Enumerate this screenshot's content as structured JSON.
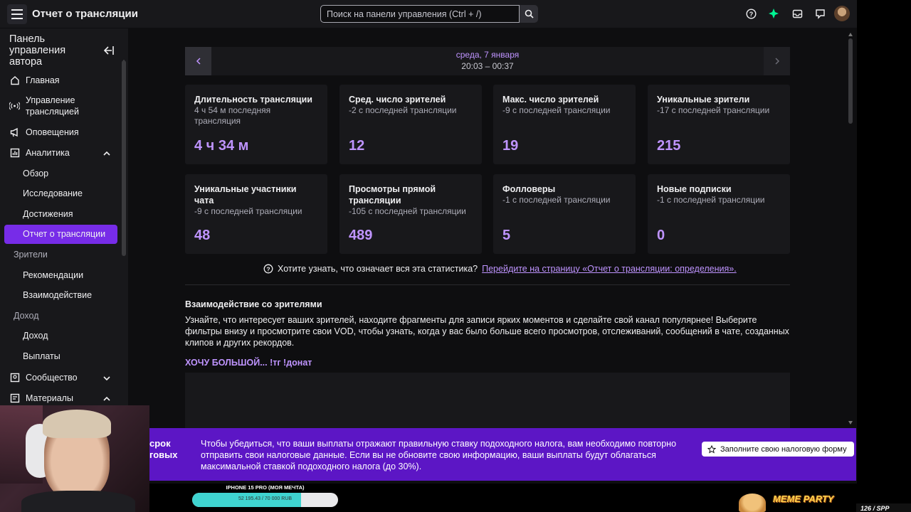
{
  "header": {
    "title": "Отчет о трансляции",
    "search_placeholder": "Поиск на панели управления (Ctrl + /)"
  },
  "sidebar": {
    "title": "Панель управления автора",
    "items": [
      {
        "label": "Главная",
        "icon": "home-icon"
      },
      {
        "label": "Управление трансляцией",
        "icon": "broadcast-icon"
      },
      {
        "label": "Оповещения",
        "icon": "megaphone-icon"
      },
      {
        "label": "Аналитика",
        "icon": "analytics-icon"
      },
      {
        "label": "Сообщество",
        "icon": "community-icon"
      },
      {
        "label": "Материалы",
        "icon": "content-icon"
      }
    ],
    "analytics_sub": [
      "Обзор",
      "Исследование",
      "Достижения",
      "Отчет о трансляции"
    ],
    "group_viewers": "Зрители",
    "viewers_sub": [
      "Рекомендации",
      "Взаимодействие"
    ],
    "group_income": "Доход",
    "income_sub": [
      "Доход",
      "Выплаты"
    ]
  },
  "date": {
    "day": "среда, 7 января",
    "time": "20:03 – 00:37"
  },
  "cards": [
    {
      "title": "Длительность трансляции",
      "sub": "4 ч 54 м последняя трансляция",
      "value": "4 ч 34 м"
    },
    {
      "title": "Сред. число зрителей",
      "sub": "-2 с последней трансляции",
      "value": "12"
    },
    {
      "title": "Макс. число зрителей",
      "sub": "-9 с последней трансляции",
      "value": "19"
    },
    {
      "title": "Уникальные зрители",
      "sub": "-17 с последней трансляции",
      "value": "215"
    },
    {
      "title": "Уникальные участники чата",
      "sub": "-9 с последней трансляции",
      "value": "48"
    },
    {
      "title": "Просмотры прямой трансляции",
      "sub": "-105 с последней трансляции",
      "value": "489"
    },
    {
      "title": "Фолловеры",
      "sub": "-1 с последней трансляции",
      "value": "5"
    },
    {
      "title": "Новые подписки",
      "sub": "-1 с последней трансляции",
      "value": "0"
    }
  ],
  "help": {
    "question": "Хотите узнать, что означает вся эта статистика?",
    "link": "Перейдите на страницу «Отчет о трансляции: определения»."
  },
  "engagement": {
    "title": "Взаимодействие со зрителями",
    "text": "Узнайте, что интересует ваших зрителей, находите фрагменты для записи ярких моментов и сделайте свой канал популярнее! Выберите фильтры внизу и просмотрите свои VOD, чтобы узнать, когда у вас было больше всего просмотров, отслеживаний, сообщений в чате, созданных клипов и других рекордов.",
    "vod_title": "ХОЧУ БОЛЬШОЙ... !тг !донат"
  },
  "banner": {
    "left": "срок говых",
    "text": "Чтобы убедиться, что ваши выплаты отражают правильную ставку подоходного налога, вам необходимо повторно отправить свои налоговые данные. Если вы не обновите свою информацию, ваши выплаты будут облагаться максимальной ставкой подоходного налога (до 30%).",
    "button": "Заполните свою налоговую форму"
  },
  "overlay": {
    "goal_title": "IPHONE 15 PRO (МОЯ МЕЧТА)",
    "goal_text": "52 195.43 / 70 000 RUB",
    "goal_progress": 0.746,
    "meme_label": "MEME PARTY",
    "counter": "126 / SPP"
  },
  "colors": {
    "accent": "#bf94ff",
    "active": "#772ce8",
    "banner": "#5c16c5"
  }
}
